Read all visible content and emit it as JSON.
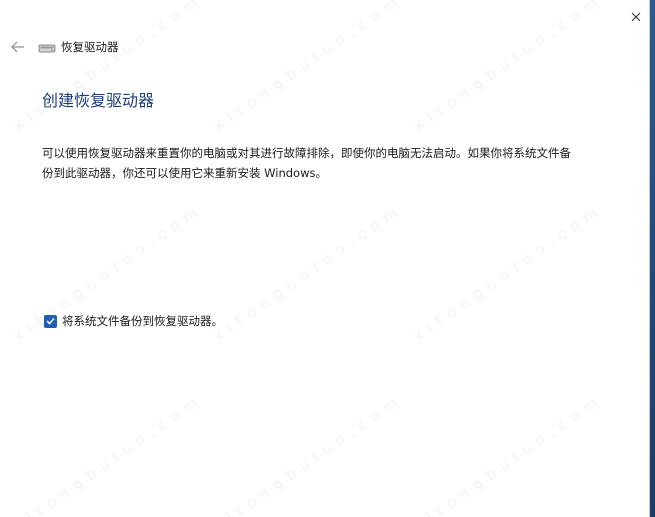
{
  "window": {
    "title": "恢复驱动器",
    "close_icon": "close-icon",
    "back_icon": "back-arrow-icon",
    "drive_icon": "drive-icon"
  },
  "page": {
    "heading": "创建恢复驱动器",
    "description": "可以使用恢复驱动器来重置你的电脑或对其进行故障排除，即使你的电脑无法启动。如果你将系统文件备份到此驱动器，你还可以使用它来重新安装 Windows。"
  },
  "backup_option": {
    "label": "将系统文件备份到恢复驱动器。",
    "checked": true
  },
  "colors": {
    "accent": "#1f5fb8",
    "heading": "#1f3d7a"
  }
}
